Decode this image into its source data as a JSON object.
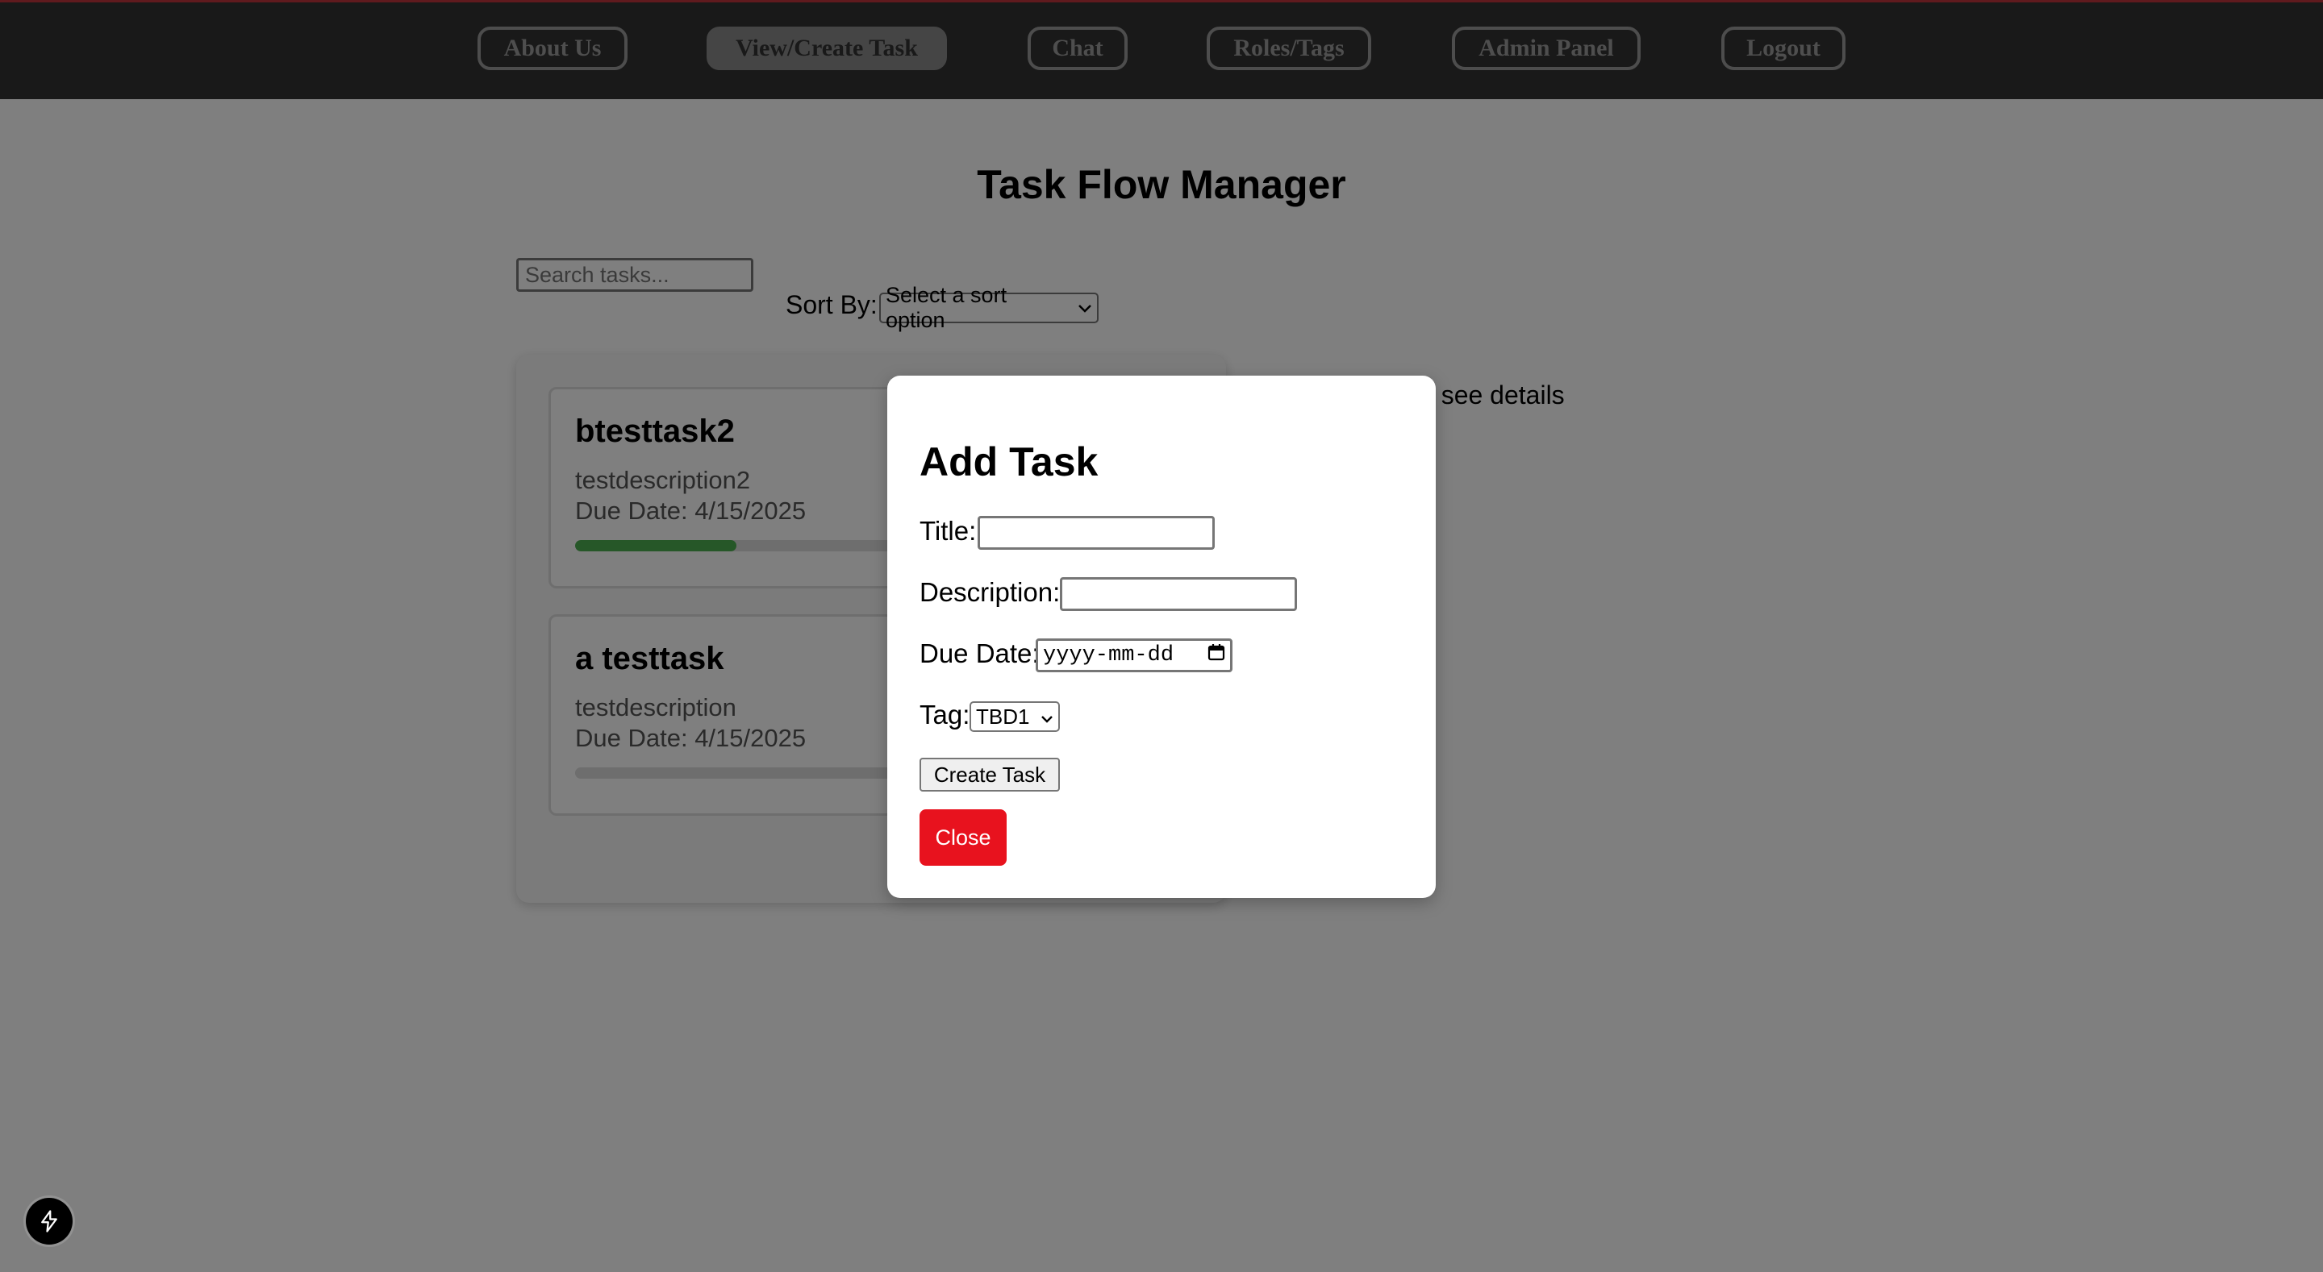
{
  "nav": {
    "items": [
      {
        "label": "About Us",
        "active": false
      },
      {
        "label": "View/Create Task",
        "active": true
      },
      {
        "label": "Chat",
        "active": false
      },
      {
        "label": "Roles/Tags",
        "active": false
      },
      {
        "label": "Admin Panel",
        "active": false
      },
      {
        "label": "Logout",
        "active": false
      }
    ]
  },
  "main": {
    "title": "Task Flow Manager",
    "search_placeholder": "Search tasks...",
    "sort_label": "Sort By:",
    "sort_selected": "Select a sort option",
    "details_hint": "o see details",
    "tasks": [
      {
        "title": "btesttask2",
        "description": "testdescription2",
        "due": "Due Date: 4/15/2025",
        "progress": 0.27
      },
      {
        "title": "a testtask",
        "description": "testdescription",
        "due": "Due Date: 4/15/2025",
        "progress": 0.0
      }
    ]
  },
  "modal": {
    "heading": "Add Task",
    "title_label": "Title:",
    "description_label": "Description:",
    "due_label": "Due Date:",
    "due_placeholder": "yyyy-mm-dd",
    "tag_label": "Tag:",
    "tag_selected": "TBD1",
    "create_label": "Create Task",
    "close_label": "Close"
  },
  "colors": {
    "navbar": "#333333",
    "accent_red": "#e8121e",
    "progress_green": "#4caf50"
  },
  "icons": {
    "fab": "lightning-icon",
    "select_arrow": "chevron-down-icon",
    "calendar": "calendar-icon"
  }
}
